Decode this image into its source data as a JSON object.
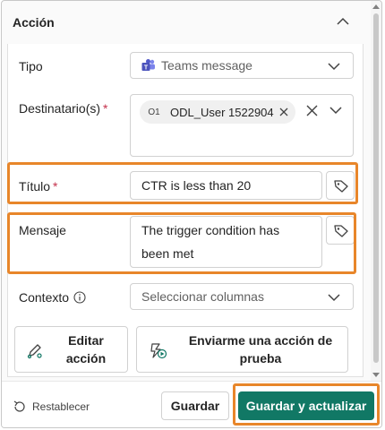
{
  "section": {
    "title": "Acción"
  },
  "fields": {
    "tipo": {
      "label": "Tipo",
      "value": "Teams message",
      "icon": "teams-icon"
    },
    "destinatario": {
      "label": "Destinatario(s)",
      "required_mark": "*",
      "chip_initials": "O1",
      "chip_name": "ODL_User 1522904"
    },
    "titulo": {
      "label": "Título",
      "required_mark": "*",
      "value": "CTR is less than 20"
    },
    "mensaje": {
      "label": "Mensaje",
      "value_line1": "The trigger condition has",
      "value_line2": "been met"
    },
    "contexto": {
      "label": "Contexto",
      "placeholder": "Seleccionar columnas",
      "info_icon": "info-icon"
    }
  },
  "actions": {
    "edit": {
      "line1": "Editar",
      "line2": "acción",
      "icon": "edit-flow-icon"
    },
    "test": {
      "line1": "Enviarme una acción de",
      "line2": "prueba",
      "icon": "send-test-icon"
    }
  },
  "footer": {
    "reset_label": "Restablecer",
    "save_label": "Guardar",
    "save_update_label": "Guardar y actualizar"
  },
  "colors": {
    "highlight": "#e8862a",
    "primary": "#117865",
    "required": "#c4314b"
  }
}
